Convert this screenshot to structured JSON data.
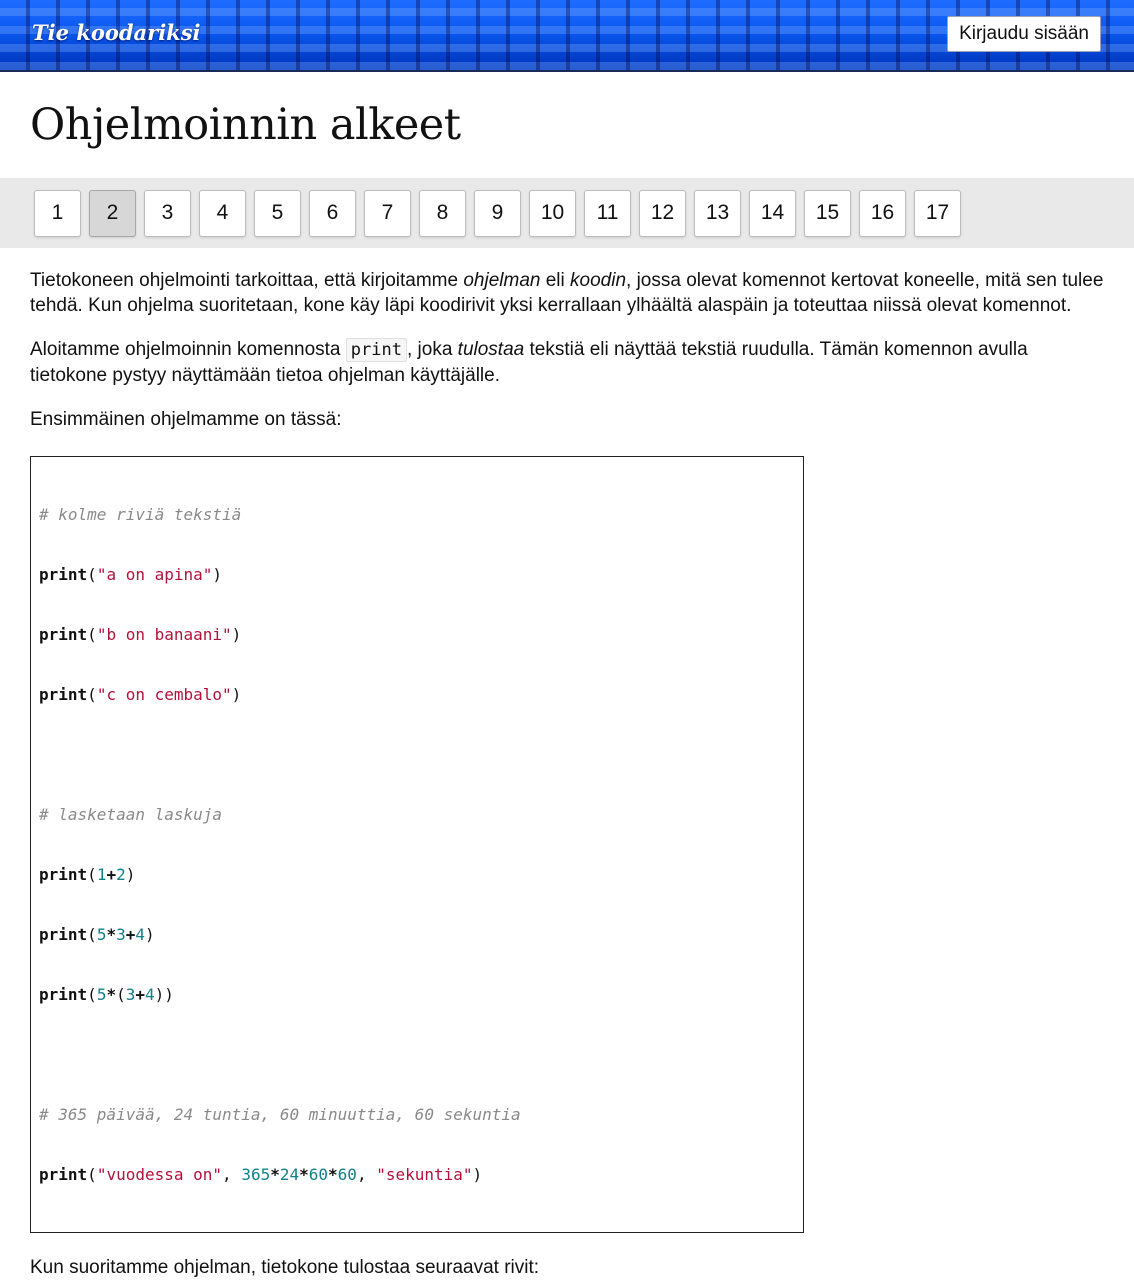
{
  "header": {
    "site_title": "Tie koodariksi",
    "login_label": "Kirjaudu sisään"
  },
  "page": {
    "title": "Ohjelmoinnin alkeet"
  },
  "pager": {
    "pages": [
      "1",
      "2",
      "3",
      "4",
      "5",
      "6",
      "7",
      "8",
      "9",
      "10",
      "11",
      "12",
      "13",
      "14",
      "15",
      "16",
      "17"
    ],
    "active": "2"
  },
  "content": {
    "p1_a": "Tietokoneen ohjelmointi tarkoittaa, että kirjoitamme ",
    "p1_em1": "ohjelman",
    "p1_b": " eli ",
    "p1_em2": "koodin",
    "p1_c": ", jossa olevat komennot kertovat koneelle, mitä sen tulee tehdä. Kun ohjelma suoritetaan, kone käy läpi koodirivit yksi kerrallaan ylhäältä alaspäin ja toteuttaa niissä olevat komennot.",
    "p2_a": "Aloitamme ohjelmoinnin komennosta ",
    "p2_code": "print",
    "p2_b": ", joka ",
    "p2_em": "tulostaa",
    "p2_c": " tekstiä eli näyttää tekstiä ruudulla. Tämän komennon avulla tietokone pystyy näyttämään tietoa ohjelman käyttäjälle.",
    "p3": "Ensimmäinen ohjelmamme on tässä:",
    "p4": "Kun suoritamme ohjelman, tietokone tulostaa seuraavat rivit:"
  },
  "code": {
    "comment1": "# kolme riviä tekstiä",
    "print_kw": "print",
    "str_a": "\"a on apina\"",
    "str_b": "\"b on banaani\"",
    "str_c": "\"c on cembalo\"",
    "comment2": "# lasketaan laskuja",
    "comment3": "# 365 päivää, 24 tuntia, 60 minuuttia, 60 sekuntia",
    "str_vuodessa": "\"vuodessa on\"",
    "str_sekuntia": "\"sekuntia\"",
    "n1": "1",
    "n2": "2",
    "n3": "3",
    "n4": "4",
    "n5": "5",
    "n365": "365",
    "n24": "24",
    "n60": "60"
  },
  "colors": {
    "header_blue": "#0a58f0",
    "pager_bg": "#e9e9e9",
    "active_page_bg": "#d7d7d7",
    "code_string": "#b3113a",
    "code_number": "#11808a",
    "code_comment": "#8a8a8a"
  }
}
